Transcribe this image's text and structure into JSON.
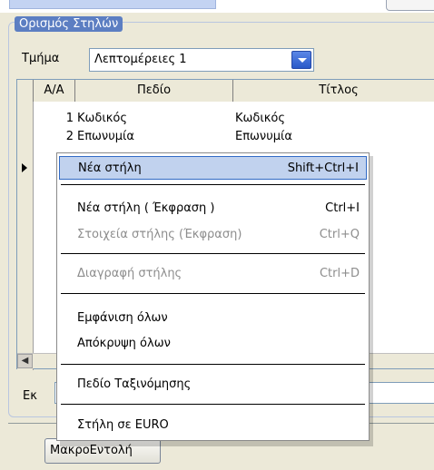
{
  "group": {
    "title": "Ορισμός Στηλών",
    "department_label": "Τμήμα",
    "department_value": "Λεπτομέρειες 1"
  },
  "grid": {
    "columns": [
      "Α/Α",
      "Πεδίο",
      "Τίτλος"
    ],
    "rows": [
      {
        "aa": "1",
        "field": "Κωδικός",
        "title": "Κωδικός"
      },
      {
        "aa": "2",
        "field": "Επωνυμία",
        "title": "Επωνυμία"
      }
    ]
  },
  "expression": {
    "label": "Εκ"
  },
  "macro_button": {
    "label": "ΜακροΕντολή"
  },
  "context_menu": {
    "items": [
      {
        "label": "Νέα στήλη",
        "shortcut": "Shift+Ctrl+I"
      },
      {
        "label": "Νέα στήλη ( Έκφραση )",
        "shortcut": "Ctrl+I"
      },
      {
        "label": "Στοιχεία στήλης (Έκφραση)",
        "shortcut": "Ctrl+Q"
      },
      {
        "label": "Διαγραφή στήλης",
        "shortcut": "Ctrl+D"
      },
      {
        "label": "Εμφάνιση όλων",
        "shortcut": ""
      },
      {
        "label": "Απόκρυψη όλων",
        "shortcut": ""
      },
      {
        "label": "Πεδίο Ταξινόμησης",
        "shortcut": ""
      },
      {
        "label": "Στήλη σε EURO",
        "shortcut": ""
      }
    ]
  }
}
